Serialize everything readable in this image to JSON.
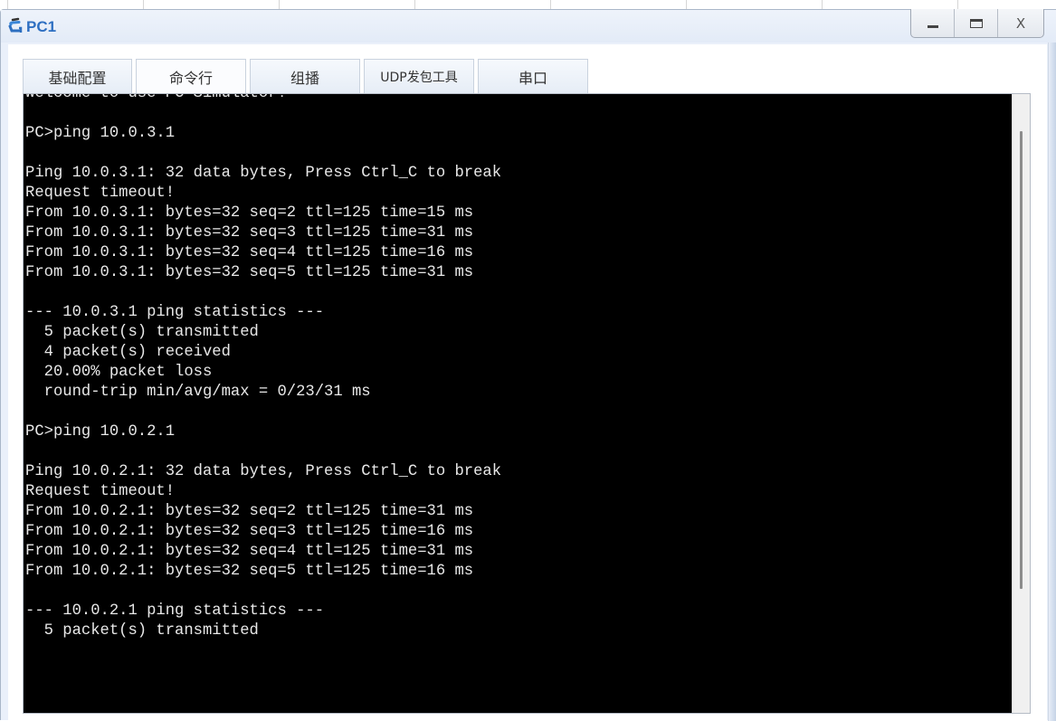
{
  "window": {
    "title": "PC1",
    "icon": "pc-network-icon",
    "controls": {
      "minimize": "minimize-icon",
      "maximize": "maximize-icon",
      "close_label": "X"
    }
  },
  "tabs": [
    {
      "label": "基础配置",
      "active": false
    },
    {
      "label": "命令行",
      "active": true
    },
    {
      "label": "组播",
      "active": false
    },
    {
      "label": "UDP发包工具",
      "active": false
    },
    {
      "label": "串口",
      "active": false
    }
  ],
  "terminal": {
    "lines": [
      "Welcome to use PC Simulator!",
      "",
      "PC>ping 10.0.3.1",
      "",
      "Ping 10.0.3.1: 32 data bytes, Press Ctrl_C to break",
      "Request timeout!",
      "From 10.0.3.1: bytes=32 seq=2 ttl=125 time=15 ms",
      "From 10.0.3.1: bytes=32 seq=3 ttl=125 time=31 ms",
      "From 10.0.3.1: bytes=32 seq=4 ttl=125 time=16 ms",
      "From 10.0.3.1: bytes=32 seq=5 ttl=125 time=31 ms",
      "",
      "--- 10.0.3.1 ping statistics ---",
      "  5 packet(s) transmitted",
      "  4 packet(s) received",
      "  20.00% packet loss",
      "  round-trip min/avg/max = 0/23/31 ms",
      "",
      "PC>ping 10.0.2.1",
      "",
      "Ping 10.0.2.1: 32 data bytes, Press Ctrl_C to break",
      "Request timeout!",
      "From 10.0.2.1: bytes=32 seq=2 ttl=125 time=31 ms",
      "From 10.0.2.1: bytes=32 seq=3 ttl=125 time=16 ms",
      "From 10.0.2.1: bytes=32 seq=4 ttl=125 time=31 ms",
      "From 10.0.2.1: bytes=32 seq=5 ttl=125 time=16 ms",
      "",
      "--- 10.0.2.1 ping statistics ---",
      "  5 packet(s) transmitted"
    ],
    "scroll": {
      "thumb_start_fraction": 0.06,
      "thumb_size_fraction": 0.74
    }
  },
  "colors": {
    "title_text": "#2e6fc2",
    "terminal_bg": "#000000",
    "terminal_fg": "#e8e8e8",
    "window_frame": "#eaf0fa"
  }
}
